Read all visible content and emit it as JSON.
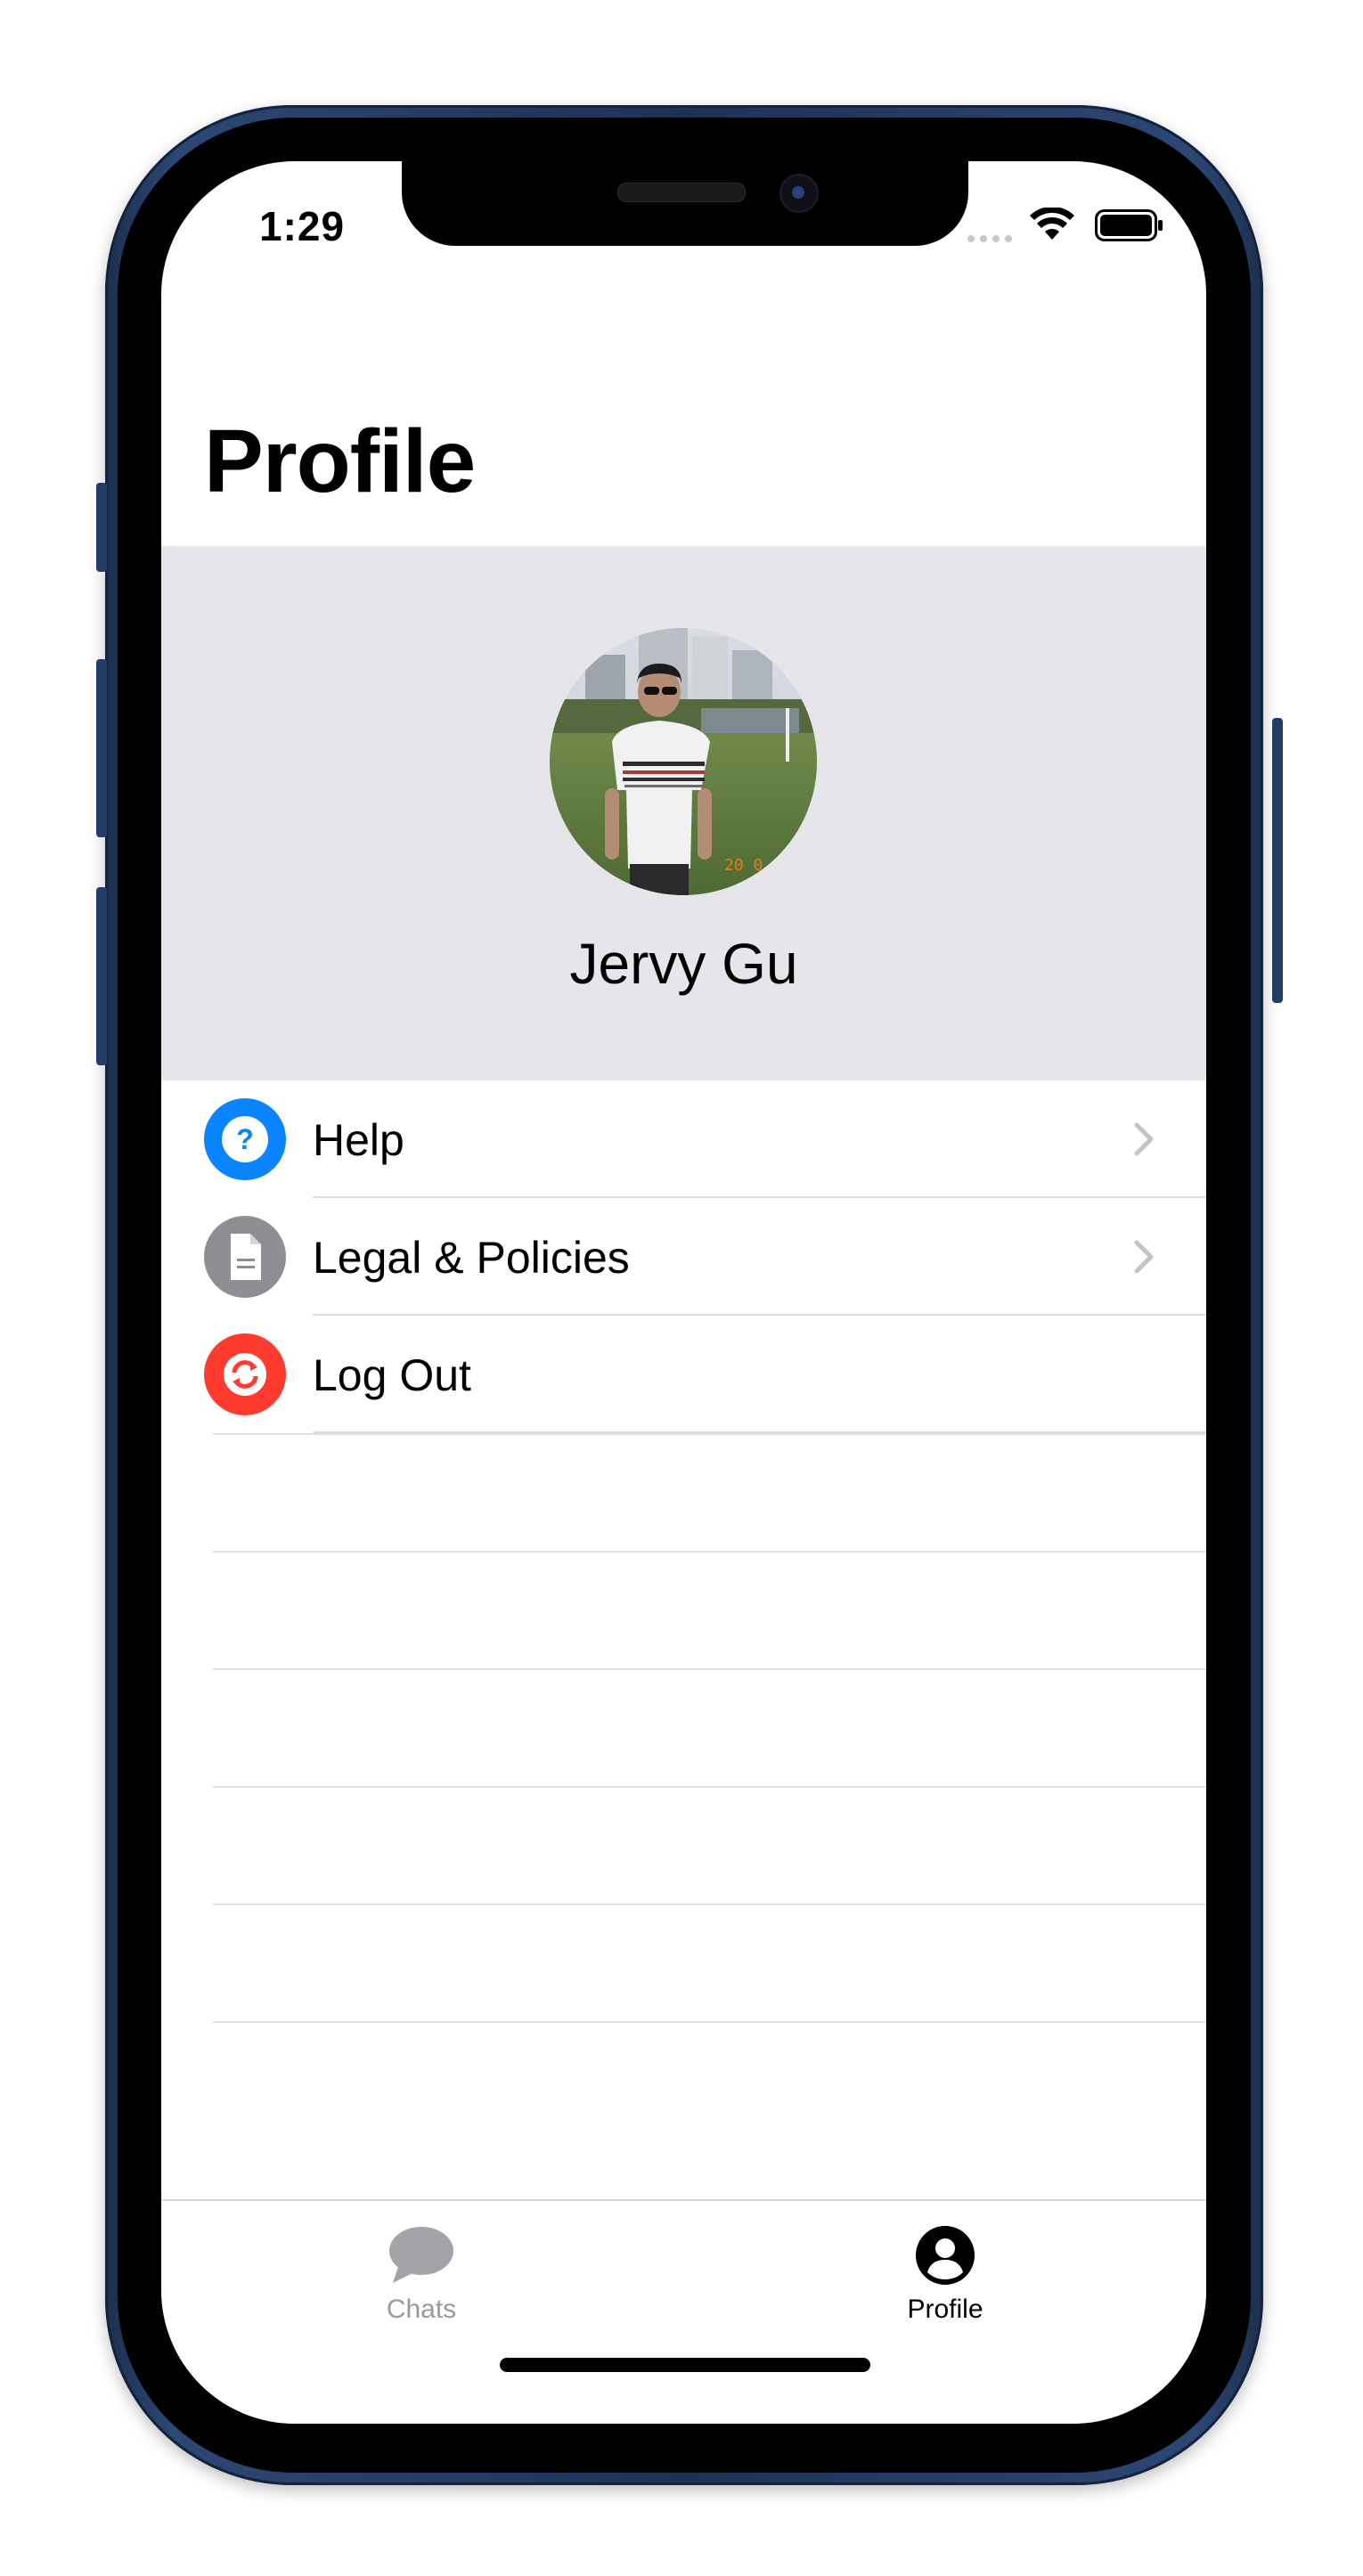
{
  "status_bar": {
    "time": "1:29"
  },
  "page": {
    "title": "Profile"
  },
  "profile": {
    "name": "Jervy Gu",
    "avatar_alt": "profile photo"
  },
  "menu": [
    {
      "label": "Help",
      "icon": "question-circle-icon",
      "color": "#0a84ff",
      "has_chevron": true
    },
    {
      "label": "Legal & Policies",
      "icon": "document-icon",
      "color": "#8e8e93",
      "has_chevron": true
    },
    {
      "label": "Log Out",
      "icon": "refresh-arrows-icon",
      "color": "#ff3b30",
      "has_chevron": false
    }
  ],
  "tabs": [
    {
      "label": "Chats",
      "icon": "chat-bubble-icon",
      "selected": false
    },
    {
      "label": "Profile",
      "icon": "person-circle-icon",
      "selected": true
    }
  ],
  "colors": {
    "header_bg": "#e5e5ea",
    "accent_blue": "#0a84ff",
    "destructive_red": "#ff3b30",
    "frame_blue": "#1d3255"
  }
}
